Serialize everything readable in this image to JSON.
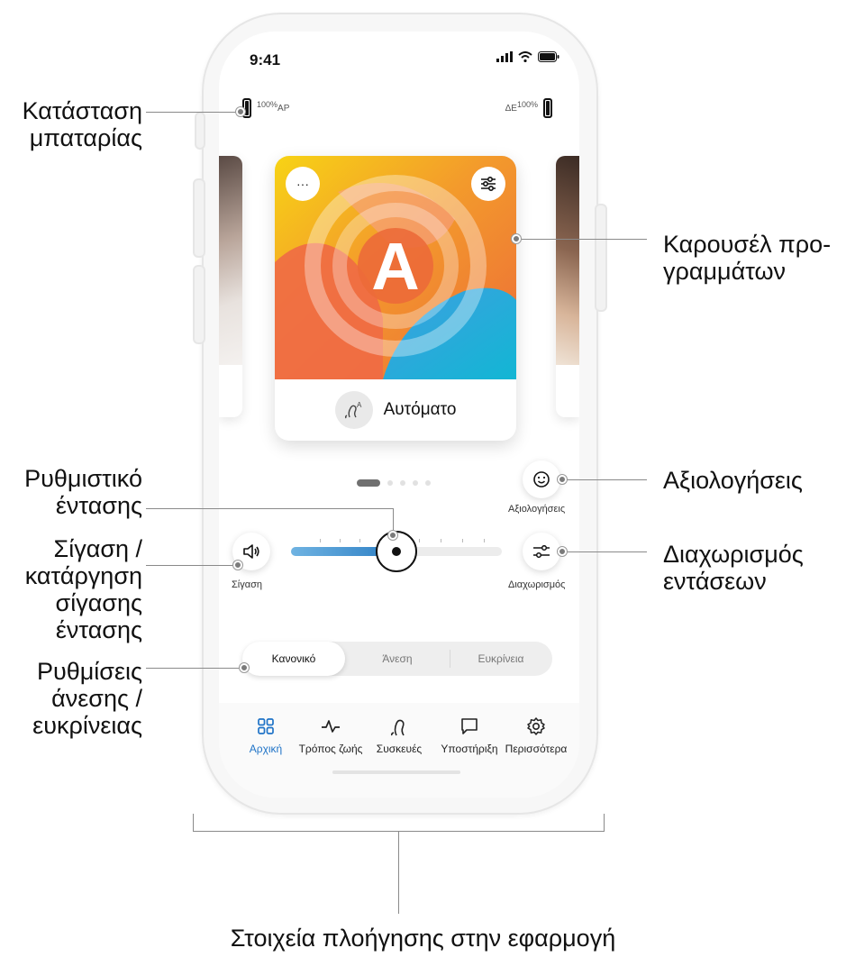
{
  "status_bar": {
    "time": "9:41"
  },
  "battery": {
    "left": {
      "side": "ΑΡ",
      "percent": "100%"
    },
    "right": {
      "side": "ΔΕ",
      "percent": "100%"
    }
  },
  "program_card": {
    "more_label": "···",
    "letter": "A",
    "name": "Αυτόματο"
  },
  "carousel": {
    "page_count": 5,
    "active_page": 1
  },
  "ratings": {
    "label": "Αξιολογήσεις",
    "icon": "smiley-icon"
  },
  "mute": {
    "label": "Σίγαση",
    "icon": "speaker-icon"
  },
  "split": {
    "label": "Διαχωρισμός",
    "icon": "sliders-icon"
  },
  "volume": {
    "level_percent": 50
  },
  "comfort_clarity": {
    "options": [
      "Κανονικό",
      "Άνεση",
      "Ευκρίνεια"
    ],
    "selected": "Κανονικό"
  },
  "nav": {
    "items": [
      {
        "label": "Αρχική",
        "icon": "grid-icon",
        "active": true
      },
      {
        "label": "Τρόπος ζωής",
        "icon": "activity-icon",
        "active": false
      },
      {
        "label": "Συσκευές",
        "icon": "hearing-aid-icon",
        "active": false
      },
      {
        "label": "Υποστήριξη",
        "icon": "chat-icon",
        "active": false
      },
      {
        "label": "Περισσότερα",
        "icon": "gear-icon",
        "active": false
      }
    ]
  },
  "annotations": {
    "battery": [
      "Κατάσταση",
      "μπαταρίας"
    ],
    "carousel": [
      "Καρουσέλ προ-",
      "γραμμάτων"
    ],
    "ratings": [
      "Αξιολογήσεις"
    ],
    "volume": [
      "Ρυθμιστικό",
      "έντασης"
    ],
    "mute": [
      "Σίγαση /",
      "κατάργηση",
      "σίγασης",
      "έντασης"
    ],
    "split": [
      "Διαχωρισμός",
      "εντάσεων"
    ],
    "comfort": [
      "Ρυθμίσεις",
      "άνεσης /",
      "ευκρίνειας"
    ],
    "navigation": [
      "Στοιχεία πλοήγησης στην εφαρμογή"
    ]
  },
  "colors": {
    "accent": "#1f73c7",
    "slider_fill": "#3c8ccf",
    "card_orange": "#f07a2e",
    "card_yellow": "#f8c80d",
    "card_blue": "#1aa3d9"
  }
}
